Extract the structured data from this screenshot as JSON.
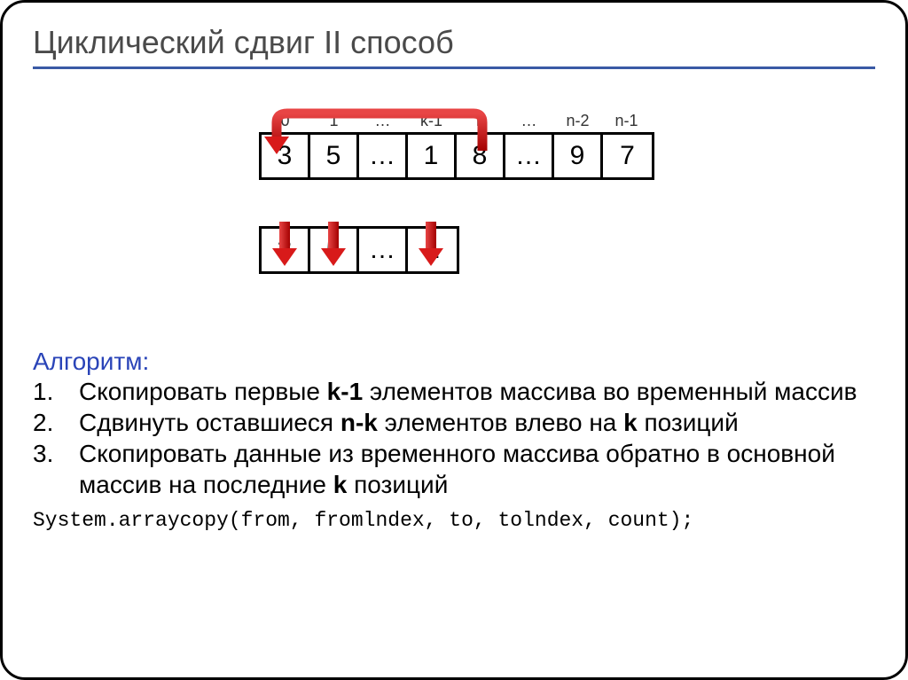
{
  "title": "Циклический сдвиг II способ",
  "indices": [
    "0",
    "1",
    "…",
    "k-1",
    "k",
    "…",
    "n-2",
    "n-1"
  ],
  "array1": [
    "3",
    "5",
    "…",
    "1",
    "8",
    "…",
    "9",
    "7"
  ],
  "array2": [
    "3",
    "5",
    "…",
    "1"
  ],
  "alg_label": "Алгоритм:",
  "steps": [
    {
      "num": "1.",
      "text": " Скопировать первые <b>k-1</b> элементов массива во временный массив"
    },
    {
      "num": "2.",
      "text": "Сдвинуть оставшиеся <b>n-k</b> элементов влево на <b>k</b> позиций"
    },
    {
      "num": "3.",
      "text": "Скопировать данные из временного массива обратно в основной массив на последние <b>k</b> позиций"
    }
  ],
  "code": "System.arraycopy(from, fromlndex, to, tolndex, count);"
}
